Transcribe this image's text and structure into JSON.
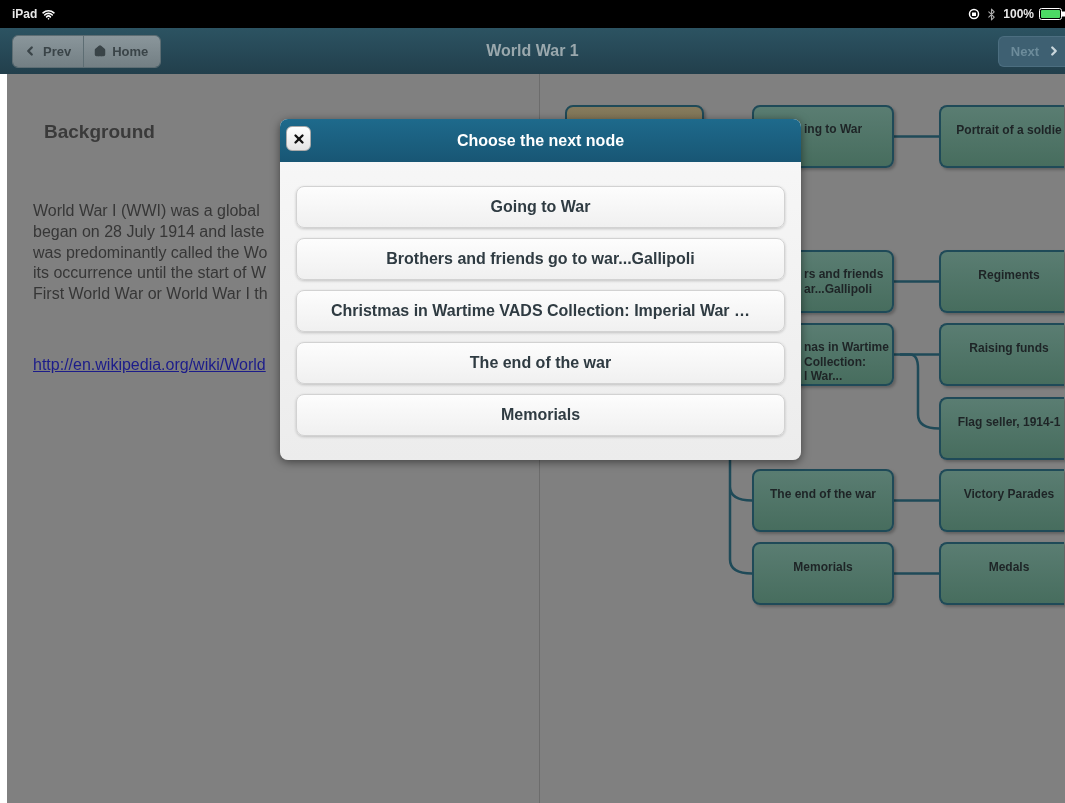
{
  "status_bar": {
    "device": "iPad",
    "battery": "100%"
  },
  "nav_bar": {
    "title": "World War 1",
    "buttons": [
      {
        "label": "Prev",
        "kind": "prev"
      },
      {
        "label": "Home",
        "kind": "home"
      }
    ],
    "next_button": {
      "label": "Next",
      "disabled": true
    }
  },
  "article": {
    "heading": "Background",
    "paragraph_lines": [
      "World War I (WWI) was a global",
      "began on 28 July 1914 and laste",
      "was predominantly called the Wo",
      "its occurrence until the start of W",
      "First World War or World War I th"
    ],
    "link": "http://en.wikipedia.org/wiki/World"
  },
  "mind_map": {
    "root": {
      "children": [
        {
          "label": "ing to War",
          "covered": true,
          "children": [
            {
              "label": "Portrait of a soldie"
            }
          ]
        },
        {
          "label": "rs and friends\nar...Gallipoli",
          "covered": true,
          "children": [
            {
              "label": "Regiments"
            }
          ]
        },
        {
          "label": "nas in Wartime\nCollection:\nl War...",
          "covered": true,
          "children": [
            {
              "label": "Raising funds"
            },
            {
              "label": "Flag seller, 1914-1"
            }
          ]
        },
        {
          "label": "The end of the war",
          "covered": false,
          "children": [
            {
              "label": "Victory Parades"
            }
          ]
        },
        {
          "label": "Memorials",
          "covered": false,
          "children": [
            {
              "label": "Medals"
            }
          ]
        }
      ]
    }
  },
  "dialog": {
    "title": "Choose the next node",
    "options": [
      "Going to War",
      "Brothers and friends go to war...Gallipoli",
      "Christmas in Wartime VADS Collection: Imperial War …",
      "The end of the war",
      "Memorials"
    ]
  }
}
